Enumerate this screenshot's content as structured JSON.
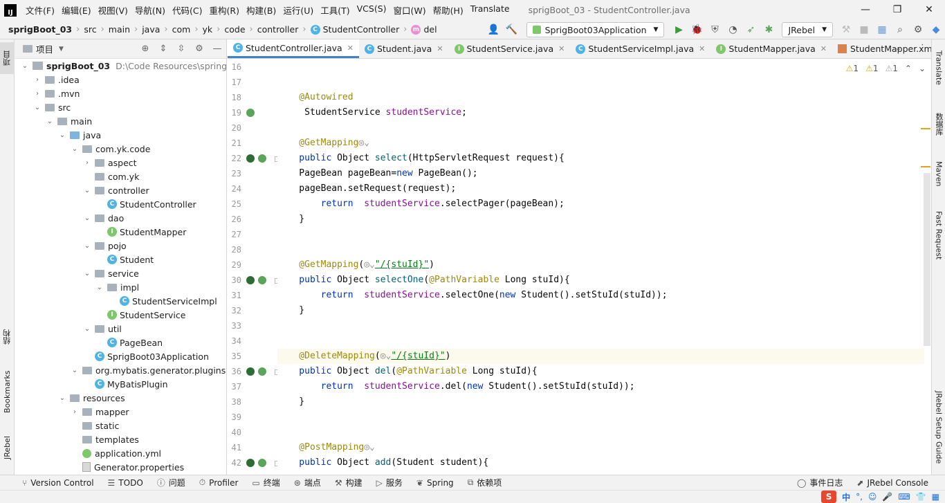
{
  "menubar": {
    "logo": "IJ",
    "items": [
      "文件(F)",
      "编辑(E)",
      "视图(V)",
      "导航(N)",
      "代码(C)",
      "重构(R)",
      "构建(B)",
      "运行(U)",
      "工具(T)",
      "VCS(S)",
      "窗口(W)",
      "帮助(H)",
      "Translate"
    ],
    "window_title": "sprigBoot_03 - StudentController.java",
    "window_controls": [
      "—",
      "❐",
      "✕"
    ]
  },
  "breadcrumb": [
    "sprigBoot_03",
    "src",
    "main",
    "java",
    "com",
    "yk",
    "code",
    "controller",
    "StudentController",
    "del"
  ],
  "toolbar": {
    "run_config": "SprigBoot03Application",
    "jrebel": "JRebel"
  },
  "left_strip": {
    "project": "项目",
    "structure": "结构",
    "bookmarks": "Bookmarks",
    "jrebel": "JRebel"
  },
  "project_panel": {
    "title": "项目",
    "tree": [
      {
        "label": "sprigBoot_03",
        "hint": "D:\\Code Resources\\springBoo",
        "icon": "module",
        "arrow": "v",
        "indent": 0,
        "bold": true
      },
      {
        "label": ".idea",
        "icon": "folder",
        "arrow": ">",
        "indent": 1
      },
      {
        "label": ".mvn",
        "icon": "folder",
        "arrow": ">",
        "indent": 1
      },
      {
        "label": "src",
        "icon": "folder",
        "arrow": "v",
        "indent": 1
      },
      {
        "label": "main",
        "icon": "folder",
        "arrow": "v",
        "indent": 2
      },
      {
        "label": "java",
        "icon": "folder-blue",
        "arrow": "v",
        "indent": 3
      },
      {
        "label": "com.yk.code",
        "icon": "folder",
        "arrow": "v",
        "indent": 4
      },
      {
        "label": "aspect",
        "icon": "folder",
        "arrow": ">",
        "indent": 5
      },
      {
        "label": "com.yk",
        "icon": "folder",
        "arrow": "",
        "indent": 5
      },
      {
        "label": "controller",
        "icon": "folder",
        "arrow": "v",
        "indent": 5
      },
      {
        "label": "StudentController",
        "icon": "class",
        "arrow": "",
        "indent": 6
      },
      {
        "label": "dao",
        "icon": "folder",
        "arrow": "v",
        "indent": 5
      },
      {
        "label": "StudentMapper",
        "icon": "interface",
        "arrow": "",
        "indent": 6
      },
      {
        "label": "pojo",
        "icon": "folder",
        "arrow": "v",
        "indent": 5
      },
      {
        "label": "Student",
        "icon": "class",
        "arrow": "",
        "indent": 6
      },
      {
        "label": "service",
        "icon": "folder",
        "arrow": "v",
        "indent": 5
      },
      {
        "label": "impl",
        "icon": "folder",
        "arrow": "v",
        "indent": 6
      },
      {
        "label": "StudentServiceImpl",
        "icon": "class",
        "arrow": "",
        "indent": 7
      },
      {
        "label": "StudentService",
        "icon": "interface",
        "arrow": "",
        "indent": 6
      },
      {
        "label": "util",
        "icon": "folder",
        "arrow": "v",
        "indent": 5
      },
      {
        "label": "PageBean",
        "icon": "class",
        "arrow": "",
        "indent": 6
      },
      {
        "label": "SprigBoot03Application",
        "icon": "class",
        "arrow": "",
        "indent": 5
      },
      {
        "label": "org.mybatis.generator.plugins",
        "icon": "folder",
        "arrow": "v",
        "indent": 4
      },
      {
        "label": "MyBatisPlugin",
        "icon": "class",
        "arrow": "",
        "indent": 5
      },
      {
        "label": "resources",
        "icon": "folder",
        "arrow": "v",
        "indent": 3
      },
      {
        "label": "mapper",
        "icon": "folder",
        "arrow": ">",
        "indent": 4
      },
      {
        "label": "static",
        "icon": "folder",
        "arrow": "",
        "indent": 4
      },
      {
        "label": "templates",
        "icon": "folder",
        "arrow": "",
        "indent": 4
      },
      {
        "label": "application.yml",
        "icon": "yml",
        "arrow": "",
        "indent": 4
      },
      {
        "label": "Generator.properties",
        "icon": "file",
        "arrow": "",
        "indent": 4
      }
    ]
  },
  "tabs": [
    {
      "label": "StudentController.java",
      "icon": "class",
      "active": true
    },
    {
      "label": "Student.java",
      "icon": "class",
      "active": false
    },
    {
      "label": "StudentService.java",
      "icon": "interface",
      "active": false
    },
    {
      "label": "StudentServiceImpl.java",
      "icon": "class",
      "active": false
    },
    {
      "label": "StudentMapper.java",
      "icon": "interface",
      "active": false
    },
    {
      "label": "StudentMapper.xml",
      "icon": "xml",
      "active": false
    }
  ],
  "inspections": [
    "1",
    "1",
    "1"
  ],
  "editor": {
    "lines": [
      {
        "n": "16",
        "tokens": []
      },
      {
        "n": "17",
        "tokens": []
      },
      {
        "n": "18",
        "tokens": [
          [
            "ann",
            "    @Autowired"
          ]
        ]
      },
      {
        "n": "19",
        "tokens": [
          [
            "plain",
            "     StudentService "
          ],
          [
            "fld",
            "studentService"
          ],
          [
            "plain",
            ";"
          ]
        ],
        "gutter": "bean"
      },
      {
        "n": "20",
        "tokens": []
      },
      {
        "n": "21",
        "tokens": [
          [
            "ann",
            "    @GetMapping"
          ],
          [
            "glob",
            "◎⌄"
          ]
        ]
      },
      {
        "n": "22",
        "tokens": [
          [
            "kw",
            "    public "
          ],
          [
            "plain",
            "Object "
          ],
          [
            "mth",
            "select"
          ],
          [
            "plain",
            "(HttpServletRequest request){"
          ]
        ],
        "gutter": "map"
      },
      {
        "n": "23",
        "tokens": [
          [
            "plain",
            "    PageBean pageBean="
          ],
          [
            "kw",
            "new "
          ],
          [
            "plain",
            "PageBean();"
          ]
        ]
      },
      {
        "n": "24",
        "tokens": [
          [
            "plain",
            "    pageBean.setRequest(request);"
          ]
        ]
      },
      {
        "n": "25",
        "tokens": [
          [
            "kw",
            "        return  "
          ],
          [
            "fld",
            "studentService"
          ],
          [
            "plain",
            ".selectPager(pageBean);"
          ]
        ]
      },
      {
        "n": "26",
        "tokens": [
          [
            "plain",
            "    }"
          ]
        ]
      },
      {
        "n": "27",
        "tokens": []
      },
      {
        "n": "28",
        "tokens": []
      },
      {
        "n": "29",
        "tokens": [
          [
            "ann",
            "    @GetMapping"
          ],
          [
            "plain",
            "("
          ],
          [
            "glob",
            "◎⌄"
          ],
          [
            "str",
            "\"/{stuId}\""
          ],
          [
            "plain",
            ")"
          ]
        ]
      },
      {
        "n": "30",
        "tokens": [
          [
            "kw",
            "    public "
          ],
          [
            "plain",
            "Object "
          ],
          [
            "mth",
            "selectOne"
          ],
          [
            "plain",
            "("
          ],
          [
            "ann",
            "@PathVariable "
          ],
          [
            "plain",
            "Long stuId){"
          ]
        ],
        "gutter": "map"
      },
      {
        "n": "31",
        "tokens": [
          [
            "kw",
            "        return  "
          ],
          [
            "fld",
            "studentService"
          ],
          [
            "plain",
            ".selectOne("
          ],
          [
            "kw",
            "new "
          ],
          [
            "plain",
            "Student().setStuId(stuId));"
          ]
        ]
      },
      {
        "n": "32",
        "tokens": [
          [
            "plain",
            "    }"
          ]
        ]
      },
      {
        "n": "33",
        "tokens": []
      },
      {
        "n": "34",
        "tokens": []
      },
      {
        "n": "35",
        "tokens": [
          [
            "ann",
            "    @DeleteMapping"
          ],
          [
            "plain",
            "("
          ],
          [
            "glob",
            "◎⌄"
          ],
          [
            "str",
            "\"/{stuId}\""
          ],
          [
            "plain",
            ")"
          ]
        ],
        "current": true
      },
      {
        "n": "36",
        "tokens": [
          [
            "kw",
            "    public "
          ],
          [
            "plain",
            "Object "
          ],
          [
            "mth",
            "del"
          ],
          [
            "plain",
            "("
          ],
          [
            "ann",
            "@PathVariable "
          ],
          [
            "plain",
            "Long stuId){"
          ]
        ],
        "gutter": "map"
      },
      {
        "n": "37",
        "tokens": [
          [
            "kw",
            "        return  "
          ],
          [
            "fld",
            "studentService"
          ],
          [
            "plain",
            ".del("
          ],
          [
            "kw",
            "new "
          ],
          [
            "plain",
            "Student().setStuId(stuId));"
          ]
        ]
      },
      {
        "n": "38",
        "tokens": [
          [
            "plain",
            "    }"
          ]
        ]
      },
      {
        "n": "39",
        "tokens": []
      },
      {
        "n": "40",
        "tokens": []
      },
      {
        "n": "41",
        "tokens": [
          [
            "ann",
            "    @PostMapping"
          ],
          [
            "glob",
            "◎⌄"
          ]
        ]
      },
      {
        "n": "42",
        "tokens": [
          [
            "kw",
            "    public "
          ],
          [
            "plain",
            "Object "
          ],
          [
            "mth",
            "add"
          ],
          [
            "plain",
            "(Student student){"
          ]
        ],
        "gutter": "map"
      }
    ]
  },
  "right_strip": {
    "translate": "Translate",
    "database": "数据库",
    "maven": "Maven",
    "fast_request": "Fast Request",
    "jrebel_guide": "JRebel Setup Guide"
  },
  "bottom_tools": [
    "Version Control",
    "TODO",
    "问题",
    "Profiler",
    "终端",
    "端点",
    "构建",
    "服务",
    "Spring",
    "依赖项"
  ],
  "bottom_right": [
    "事件日志",
    "JRebel Console"
  ],
  "status": {
    "ime": "中"
  }
}
